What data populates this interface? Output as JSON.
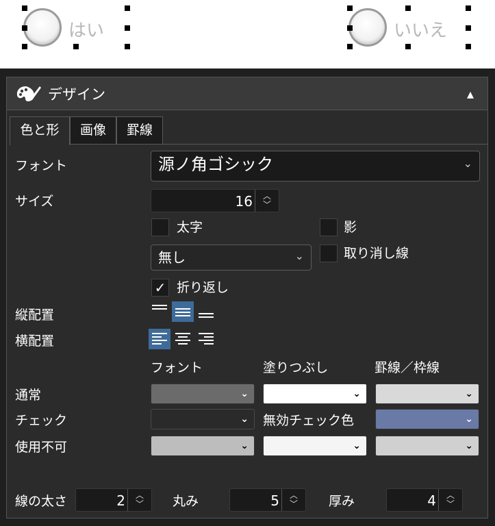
{
  "canvas": {
    "radio_yes": {
      "label": "はい"
    },
    "radio_no": {
      "label": "いいえ"
    }
  },
  "panel": {
    "title": "デザイン",
    "collapse_icon": "▴",
    "tabs": [
      {
        "label": "色と形",
        "active": true
      },
      {
        "label": "画像",
        "active": false
      },
      {
        "label": "罫線",
        "active": false
      }
    ]
  },
  "font": {
    "label": "フォント",
    "value": "源ノ角ゴシック"
  },
  "size": {
    "label": "サイズ",
    "value": "16"
  },
  "bold": {
    "label": "太字",
    "checked": false
  },
  "shadow": {
    "label": "影",
    "checked": false
  },
  "underline": {
    "value": "無し"
  },
  "strikethrough": {
    "label": "取り消し線",
    "checked": false
  },
  "wrap": {
    "label": "折り返し",
    "checked": true,
    "mark": "✓"
  },
  "valign": {
    "label": "縦配置",
    "selected": "middle"
  },
  "halign": {
    "label": "横配置",
    "selected": "left"
  },
  "color_table": {
    "headers": [
      "フォント",
      "塗りつぶし",
      "罫線／枠線"
    ],
    "rows": [
      {
        "label": "通常",
        "colors": [
          "#6b6b6b",
          "#ffffff",
          "#d9d9d9"
        ]
      },
      {
        "label": "チェック",
        "colors": [
          "#2a2a2a",
          "",
          "#6a7aa6"
        ],
        "fill_text": "無効チェック色"
      },
      {
        "label": "使用不可",
        "colors": [
          "#bdbdbd",
          "#f5f5f5",
          "#d0d0d0"
        ]
      }
    ]
  },
  "line_width": {
    "label": "線の太さ",
    "value": "2"
  },
  "roundness": {
    "label": "丸み",
    "value": "5"
  },
  "thickness": {
    "label": "厚み",
    "value": "4"
  }
}
